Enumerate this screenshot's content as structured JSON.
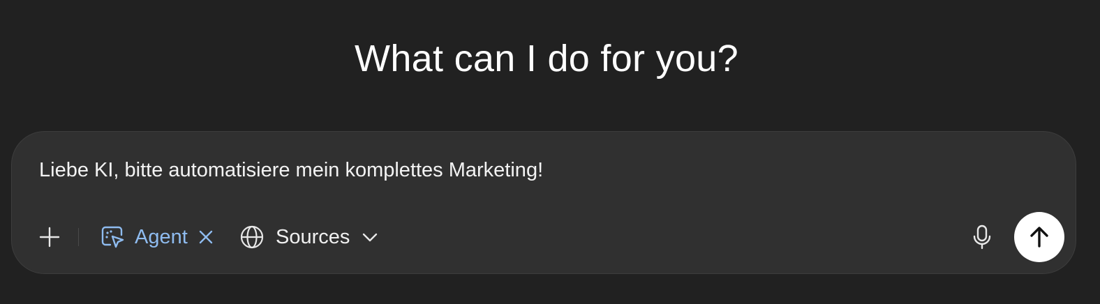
{
  "heading": "What can I do for you?",
  "composer": {
    "input_value": "Liebe KI, bitte automatisiere mein komplettes Marketing!",
    "agent_label": "Agent",
    "sources_label": "Sources"
  },
  "icons": {
    "add": "plus-icon",
    "agent": "agent-cursor-icon",
    "remove_agent": "close-icon",
    "sources": "globe-icon",
    "sources_dropdown": "chevron-down-icon",
    "voice": "microphone-icon",
    "send": "arrow-up-icon"
  },
  "colors": {
    "background": "#212121",
    "composer_background": "#303030",
    "agent_accent": "#8fbcf0",
    "send_button": "#ffffff"
  }
}
